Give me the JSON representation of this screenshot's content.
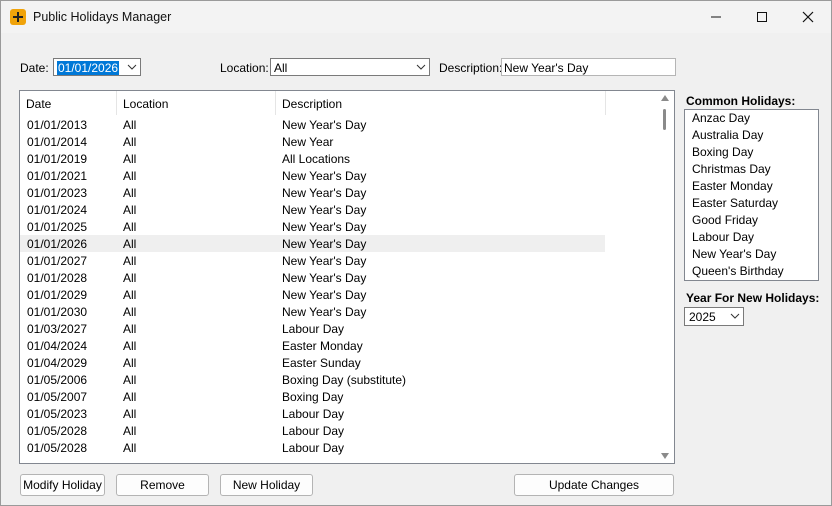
{
  "window": {
    "title": "Public Holidays Manager",
    "controls": [
      "minimize-icon",
      "maximize-icon",
      "close-icon"
    ]
  },
  "filters": {
    "date_label": "Date:",
    "date_value": "01/01/2026",
    "location_label": "Location:",
    "location_value": "All",
    "description_label": "Description:",
    "description_value": "New Year's Day"
  },
  "table": {
    "columns": [
      "Date",
      "Location",
      "Description"
    ],
    "rows": [
      {
        "date": "01/01/2013",
        "location": "All",
        "description": "New Year's Day"
      },
      {
        "date": "01/01/2014",
        "location": "All",
        "description": "New Year"
      },
      {
        "date": "01/01/2019",
        "location": "All",
        "description": "All Locations"
      },
      {
        "date": "01/01/2021",
        "location": "All",
        "description": "New Year's Day"
      },
      {
        "date": "01/01/2023",
        "location": "All",
        "description": "New Year's Day"
      },
      {
        "date": "01/01/2024",
        "location": "All",
        "description": "New Year's Day"
      },
      {
        "date": "01/01/2025",
        "location": "All",
        "description": "New Year's Day"
      },
      {
        "date": "01/01/2026",
        "location": "All",
        "description": "New Year's Day",
        "selected": true
      },
      {
        "date": "01/01/2027",
        "location": "All",
        "description": "New Year's Day"
      },
      {
        "date": "01/01/2028",
        "location": "All",
        "description": "New Year's Day"
      },
      {
        "date": "01/01/2029",
        "location": "All",
        "description": "New Year's Day"
      },
      {
        "date": "01/01/2030",
        "location": "All",
        "description": "New Year's Day"
      },
      {
        "date": "01/03/2027",
        "location": "All",
        "description": "Labour Day"
      },
      {
        "date": "01/04/2024",
        "location": "All",
        "description": "Easter Monday"
      },
      {
        "date": "01/04/2029",
        "location": "All",
        "description": "Easter Sunday"
      },
      {
        "date": "01/05/2006",
        "location": "All",
        "description": "Boxing Day (substitute)"
      },
      {
        "date": "01/05/2007",
        "location": "All",
        "description": "Boxing Day"
      },
      {
        "date": "01/05/2023",
        "location": "All",
        "description": "Labour Day"
      },
      {
        "date": "01/05/2028",
        "location": "All",
        "description": "Labour Day"
      },
      {
        "date": "01/05/2028",
        "location": "All",
        "description": "Labour Day"
      }
    ]
  },
  "buttons": {
    "modify": "Modify Holiday",
    "remove": "Remove",
    "new": "New Holiday",
    "update": "Update Changes"
  },
  "common_holidays": {
    "title": "Common Holidays:",
    "items": [
      "Anzac Day",
      "Australia Day",
      "Boxing Day",
      "Christmas Day",
      "Easter Monday",
      "Easter Saturday",
      "Good Friday",
      "Labour Day",
      "New Year's Day",
      "Queen's Birthday"
    ]
  },
  "year": {
    "title": "Year For New Holidays:",
    "value": "2025"
  },
  "colors": {
    "selection": "#0078d7",
    "window_bg": "#f0f0f0",
    "accent_icon": "#f0a30a"
  }
}
